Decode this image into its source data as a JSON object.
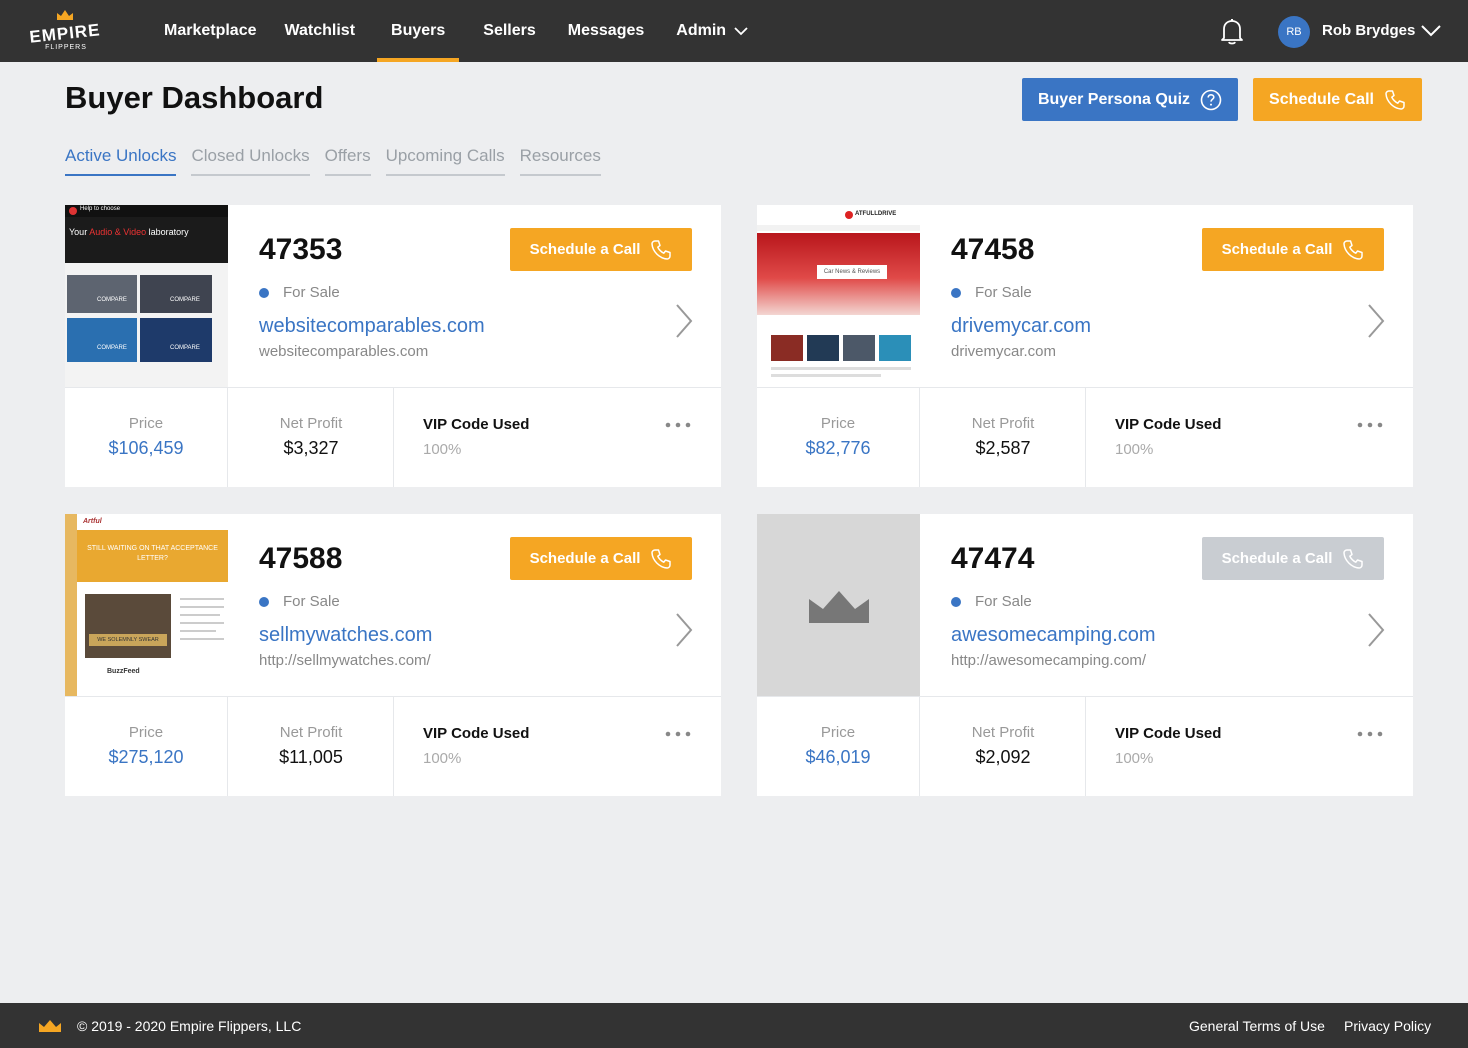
{
  "brand": {
    "logo_text": "EMPIRE",
    "logo_sub": "FLIPPERS",
    "accent_orange": "#f5a623",
    "accent_blue": "#3a75c4",
    "nav_bg": "#333333"
  },
  "nav": {
    "items": [
      {
        "label": "Marketplace"
      },
      {
        "label": "Watchlist"
      },
      {
        "label": "Buyers"
      },
      {
        "label": "Sellers"
      },
      {
        "label": "Messages"
      },
      {
        "label": "Admin"
      }
    ],
    "active": "Buyers"
  },
  "user": {
    "initials": "RB",
    "name": "Rob Brydges"
  },
  "header": {
    "title": "Buyer Dashboard",
    "quiz_label": "Buyer Persona Quiz",
    "schedule_label": "Schedule Call"
  },
  "tabs": [
    {
      "label": "Active Unlocks"
    },
    {
      "label": "Closed Unlocks"
    },
    {
      "label": "Offers"
    },
    {
      "label": "Upcoming Calls"
    },
    {
      "label": "Resources"
    }
  ],
  "cards": [
    {
      "id": "47353",
      "status": "For Sale",
      "site": "websitecomparables.com",
      "site_sub": "websitecomparables.com",
      "call_label": "Schedule a Call",
      "call_enabled": true,
      "price_label": "Price",
      "price": "$106,459",
      "profit_label": "Net Profit",
      "profit": "$3,327",
      "vip_label": "VIP Code Used",
      "vip_value": "100%",
      "thumb": {
        "brand": "Help to choose",
        "headline_a": "Your",
        "headline_b": "Audio & Video",
        "headline_c": "laboratory",
        "tile1": "COMPARE",
        "tile2": "COMPARE",
        "tile3": "COMPARE",
        "tile4": "COMPARE"
      }
    },
    {
      "id": "47458",
      "status": "For Sale",
      "site": "drivemycar.com",
      "site_sub": "drivemycar.com",
      "call_label": "Schedule a Call",
      "call_enabled": true,
      "price_label": "Price",
      "price": "$82,776",
      "profit_label": "Net Profit",
      "profit": "$2,587",
      "vip_label": "VIP Code Used",
      "vip_value": "100%",
      "thumb": {
        "brand": "ATFULLDRIVE",
        "banner": "Car News & Reviews"
      }
    },
    {
      "id": "47588",
      "status": "For Sale",
      "site": "sellmywatches.com",
      "site_sub": "http://sellmywatches.com/",
      "call_label": "Schedule a Call",
      "call_enabled": true,
      "price_label": "Price",
      "price": "$275,120",
      "profit_label": "Net Profit",
      "profit": "$11,005",
      "vip_label": "VIP Code Used",
      "vip_value": "100%",
      "thumb": {
        "brand": "Artful",
        "banner": "STILL WAITING ON THAT ACCEPTANCE LETTER?",
        "promo": "WE SOLEMNLY SWEAR",
        "feed": "BuzzFeed"
      }
    },
    {
      "id": "47474",
      "status": "For Sale",
      "site": "awesomecamping.com",
      "site_sub": "http://awesomecamping.com/",
      "call_label": "Schedule a Call",
      "call_enabled": false,
      "price_label": "Price",
      "price": "$46,019",
      "profit_label": "Net Profit",
      "profit": "$2,092",
      "vip_label": "VIP Code Used",
      "vip_value": "100%",
      "thumb": {}
    }
  ],
  "footer": {
    "copyright": "© 2019 - 2020 Empire Flippers, LLC",
    "terms": "General Terms of Use",
    "privacy": "Privacy Policy"
  }
}
